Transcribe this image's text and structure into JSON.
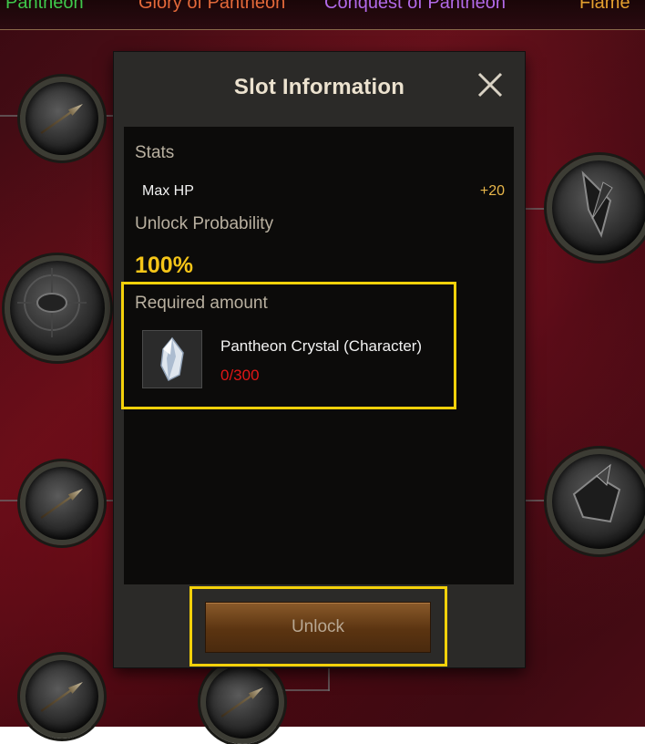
{
  "tabs": [
    "Pantheon",
    "Glory of Pantheon",
    "Conquest of Pantheon",
    "Flame"
  ],
  "modal": {
    "title": "Slot Information",
    "stats_label": "Stats",
    "stat": {
      "name": "Max HP",
      "value": "+20"
    },
    "probability_label": "Unlock Probability",
    "probability_value": "100%",
    "required_label": "Required amount",
    "item": {
      "name": "Pantheon Crystal (Character)",
      "count": "0/300",
      "icon": "crystal-icon"
    },
    "unlock_label": "Unlock"
  },
  "colors": {
    "highlight": "#f4d10a",
    "probability": "#f5c518",
    "stat_value": "#e8b64a",
    "count": "#e01616",
    "button": "#5b3411"
  }
}
